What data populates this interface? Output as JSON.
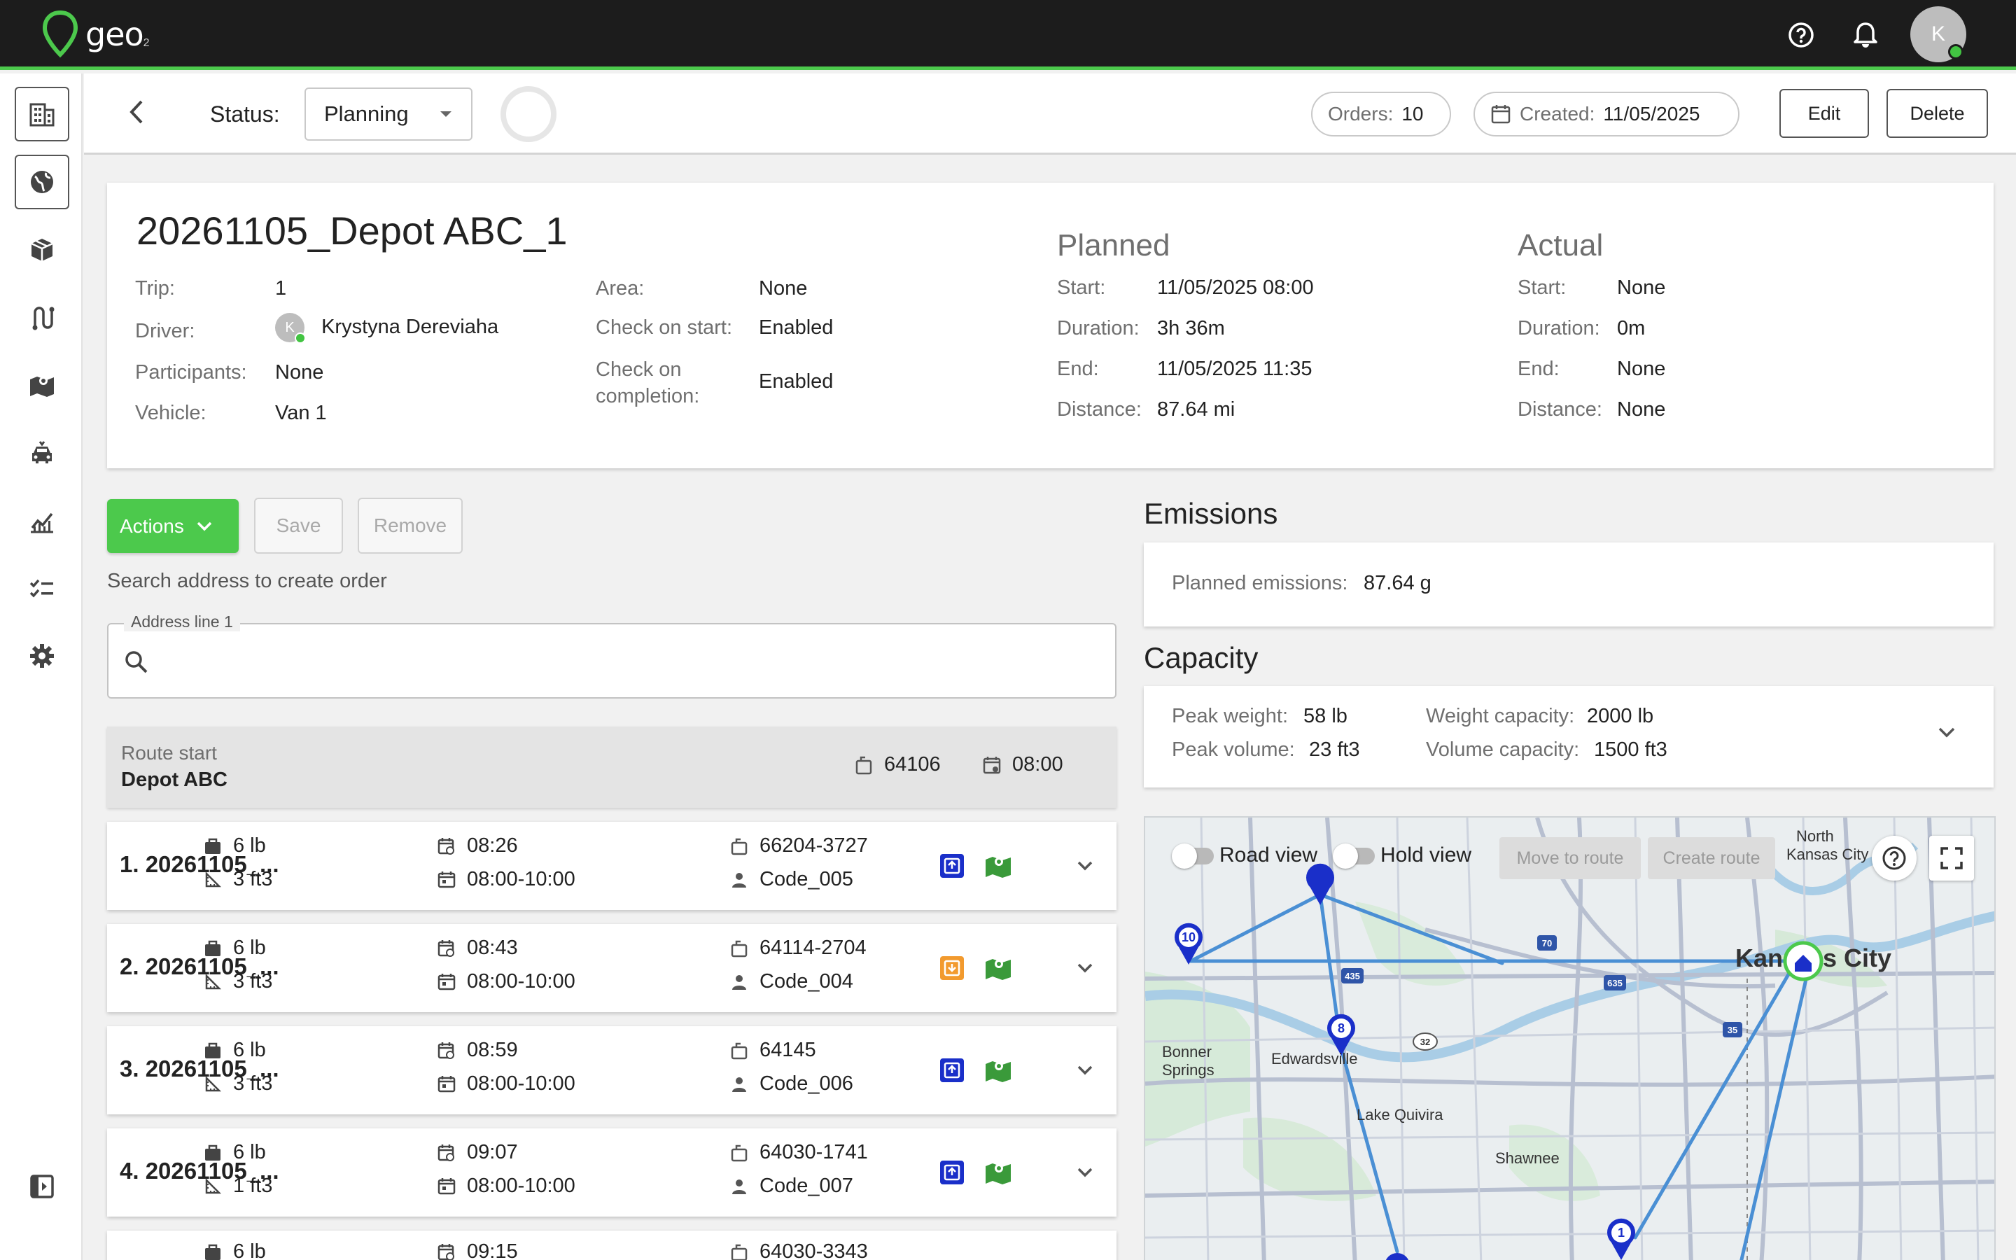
{
  "app": {
    "logo_text": "geo",
    "logo_sub": "2",
    "user_initial": "K"
  },
  "header": {
    "status_label": "Status:",
    "status_value": "Planning",
    "orders_label": "Orders:",
    "orders_value": "10",
    "created_label": "Created:",
    "created_value": "11/05/2025",
    "edit_label": "Edit",
    "delete_label": "Delete"
  },
  "trip": {
    "title": "20261105_Depot ABC_1",
    "trip_label": "Trip:",
    "trip_value": "1",
    "driver_label": "Driver:",
    "driver_initial": "K",
    "driver_value": "Krystyna Dereviaha",
    "participants_label": "Participants:",
    "participants_value": "None",
    "vehicle_label": "Vehicle:",
    "vehicle_value": "Van 1",
    "area_label": "Area:",
    "area_value": "None",
    "check_start_label": "Check on start:",
    "check_start_value": "Enabled",
    "check_completion_label": "Check on completion:",
    "check_completion_value": "Enabled",
    "planned": {
      "heading": "Planned",
      "start_label": "Start:",
      "start_value": "11/05/2025 08:00",
      "duration_label": "Duration:",
      "duration_value": "3h 36m",
      "end_label": "End:",
      "end_value": "11/05/2025 11:35",
      "distance_label": "Distance:",
      "distance_value": "87.64 mi"
    },
    "actual": {
      "heading": "Actual",
      "start_label": "Start:",
      "start_value": "None",
      "duration_label": "Duration:",
      "duration_value": "0m",
      "end_label": "End:",
      "end_value": "None",
      "distance_label": "Distance:",
      "distance_value": "None"
    }
  },
  "actions": {
    "actions_label": "Actions",
    "save_label": "Save",
    "remove_label": "Remove",
    "search_hint": "Search address to create order",
    "address_label": "Address line 1",
    "address_value": ""
  },
  "route_start": {
    "label": "Route start",
    "name": "Depot ABC",
    "zip": "64106",
    "time": "08:00"
  },
  "orders": [
    {
      "title": "1. 20261105_...",
      "weight": "6 lb",
      "volume": "3 ft3",
      "eta": "08:26",
      "window": "08:00-10:00",
      "zip": "66204-3727",
      "code": "Code_005",
      "status": "delivery"
    },
    {
      "title": "2. 20261105_...",
      "weight": "6 lb",
      "volume": "3 ft3",
      "eta": "08:43",
      "window": "08:00-10:00",
      "zip": "64114-2704",
      "code": "Code_004",
      "status": "pickup"
    },
    {
      "title": "3. 20261105_...",
      "weight": "6 lb",
      "volume": "3 ft3",
      "eta": "08:59",
      "window": "08:00-10:00",
      "zip": "64145",
      "code": "Code_006",
      "status": "delivery"
    },
    {
      "title": "4. 20261105_...",
      "weight": "6 lb",
      "volume": "1 ft3",
      "eta": "09:07",
      "window": "08:00-10:00",
      "zip": "64030-1741",
      "code": "Code_007",
      "status": "delivery"
    },
    {
      "title": "",
      "weight": "6 lb",
      "volume": "",
      "eta": "09:15",
      "window": "",
      "zip": "64030-3343",
      "code": "",
      "status": ""
    }
  ],
  "emissions": {
    "heading": "Emissions",
    "planned_label": "Planned emissions:",
    "planned_value": "87.64 g"
  },
  "capacity": {
    "heading": "Capacity",
    "peak_weight_label": "Peak weight:",
    "peak_weight_value": "58 lb",
    "peak_volume_label": "Peak volume:",
    "peak_volume_value": "23 ft3",
    "weight_capacity_label": "Weight capacity:",
    "weight_capacity_value": "2000 lb",
    "volume_capacity_label": "Volume capacity:",
    "volume_capacity_value": "1500 ft3"
  },
  "map": {
    "road_view": "Road view",
    "hold_view": "Hold view",
    "move_to_route": "Move to route",
    "create_route": "Create route",
    "labels": {
      "north_kc_1": "North",
      "north_kc_2": "Kansas City",
      "kansas_city_a": "Kan",
      "kansas_city_b": "s City",
      "bonner_1": "Bonner",
      "bonner_2": "Springs",
      "edwardsville": "Edwardsville",
      "lake_quivira": "Lake Quivira",
      "shawnee": "Shawnee"
    },
    "markers": [
      "10",
      "8",
      "1"
    ],
    "highways": [
      "435",
      "70",
      "635",
      "35",
      "32"
    ]
  },
  "colors": {
    "brand_green": "#4cc94c",
    "route_blue": "#4a8fd4",
    "marker_blue": "#1a2fc9",
    "pickup_orange": "#f29a2e",
    "map_icon_green": "#3a9a3a"
  }
}
